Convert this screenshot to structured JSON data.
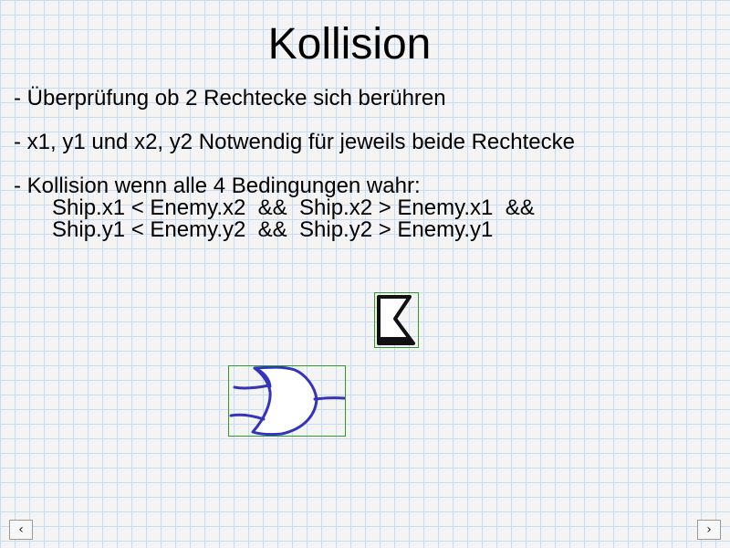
{
  "slide": {
    "title": "Kollision",
    "bullets": [
      "- Überprüfung ob 2 Rechtecke sich berühren",
      "- x1, y1 und x2, y2 Notwendig für jeweils beide Rechtecke",
      "- Kollision wenn alle 4 Bedingungen wahr:"
    ],
    "conditions": [
      "Ship.x1 < Enemy.x2  &&  Ship.x2 > Enemy.x1  &&",
      "Ship.y1 < Enemy.y2  &&  Ship.y2 > Enemy.y1"
    ]
  },
  "navigation": {
    "prev_label": "‹",
    "next_label": "›"
  },
  "colors": {
    "grid_line": "#c9dcef",
    "bounding_box": "#2e9a2e",
    "ship_stroke": "#3333bb"
  },
  "icons": {
    "enemy": "enemy-sprite-icon",
    "ship": "ship-sprite-icon"
  }
}
